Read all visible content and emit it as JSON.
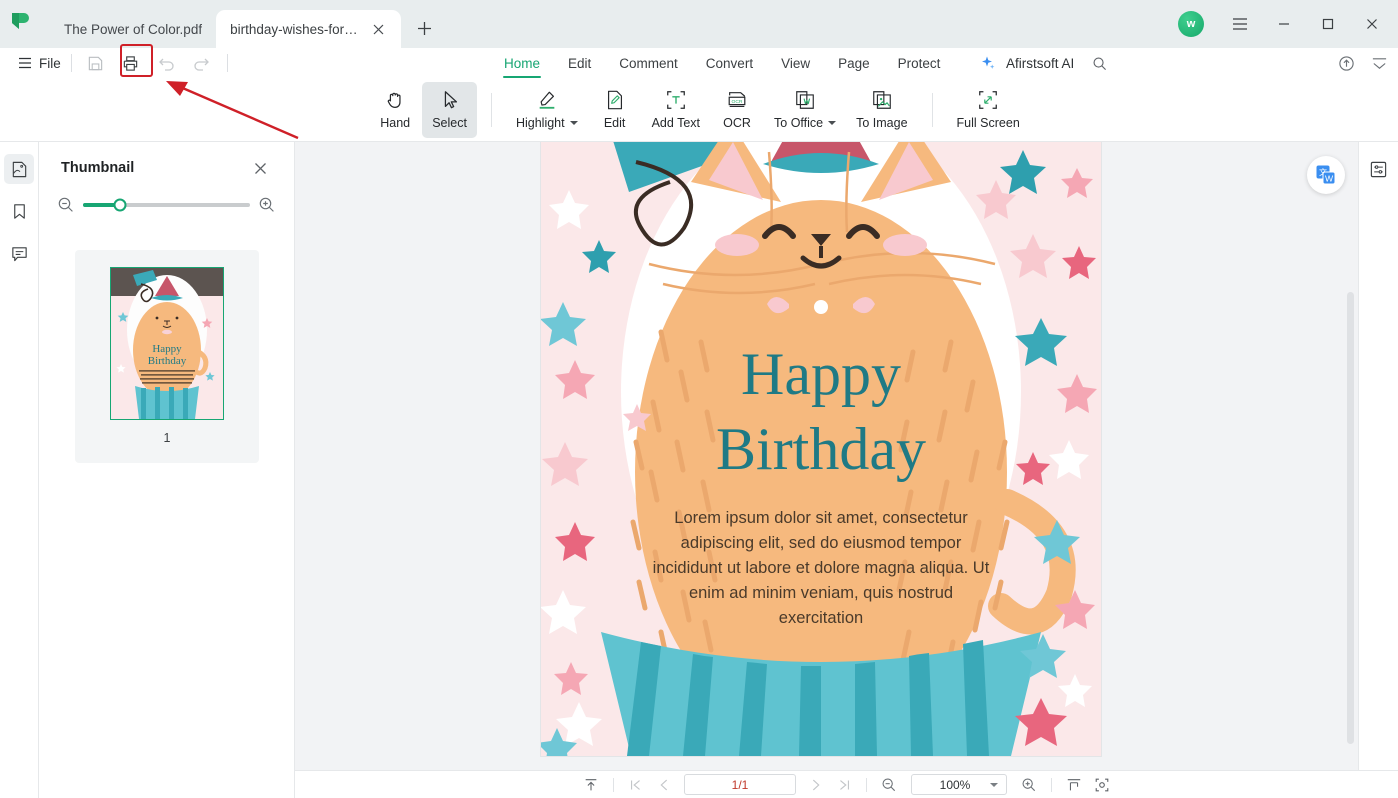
{
  "window": {
    "avatar_initial": "w",
    "controls": [
      "menu-icon",
      "minimize-icon",
      "maximize-icon",
      "close-icon"
    ]
  },
  "tabs": [
    {
      "label": "The Power of Color.pdf",
      "active": false
    },
    {
      "label": "birthday-wishes-for-gra...",
      "active": true
    }
  ],
  "newtab_label": "+",
  "file_menu": {
    "label": "File"
  },
  "quick_actions": [
    {
      "name": "save-button",
      "label": "Save",
      "enabled": true
    },
    {
      "name": "print-button",
      "label": "Print",
      "enabled": true,
      "highlighted": true
    },
    {
      "name": "undo-button",
      "label": "Undo",
      "enabled": false
    },
    {
      "name": "redo-button",
      "label": "Redo",
      "enabled": false
    }
  ],
  "menu_tabs": [
    {
      "label": "Home",
      "active": true
    },
    {
      "label": "Edit",
      "active": false
    },
    {
      "label": "Comment",
      "active": false
    },
    {
      "label": "Convert",
      "active": false
    },
    {
      "label": "View",
      "active": false
    },
    {
      "label": "Page",
      "active": false
    },
    {
      "label": "Protect",
      "active": false
    }
  ],
  "ai": {
    "label": "Afirstsoft AI",
    "icon": "sparkle-icon"
  },
  "menu_right_icons": [
    "search-icon",
    "cloud-upload-icon",
    "collapse-ribbon-icon"
  ],
  "ribbon": [
    {
      "label": "Hand",
      "icon": "hand-icon",
      "active": false,
      "dropdown": false
    },
    {
      "label": "Select",
      "icon": "cursor-icon",
      "active": true,
      "dropdown": false
    },
    {
      "label": "Highlight",
      "icon": "highlighter-icon",
      "active": false,
      "dropdown": true
    },
    {
      "label": "Edit",
      "icon": "edit-document-icon",
      "active": false,
      "dropdown": false
    },
    {
      "label": "Add Text",
      "icon": "add-text-icon",
      "active": false,
      "dropdown": false
    },
    {
      "label": "OCR",
      "icon": "ocr-icon",
      "active": false,
      "dropdown": false
    },
    {
      "label": "To Office",
      "icon": "to-office-icon",
      "active": false,
      "dropdown": true
    },
    {
      "label": "To Image",
      "icon": "to-image-icon",
      "active": false,
      "dropdown": false
    },
    {
      "label": "Full Screen",
      "icon": "fullscreen-icon",
      "active": false,
      "dropdown": false
    }
  ],
  "left_rail": [
    {
      "name": "thumbnail",
      "icon": "thumbnail-icon",
      "active": true
    },
    {
      "name": "bookmark",
      "icon": "bookmark-icon",
      "active": false
    },
    {
      "name": "comment",
      "icon": "comment-icon",
      "active": false
    }
  ],
  "thumbnail_panel": {
    "title": "Thumbnail",
    "close_icon": "close-icon",
    "zoom_out_icon": "zoom-out-icon",
    "zoom_in_icon": "zoom-in-icon",
    "slider_value": 22,
    "pages": [
      {
        "number": "1",
        "selected": true
      }
    ]
  },
  "document": {
    "title_line1": "Happy",
    "title_line2": "Birthday",
    "body": "Lorem ipsum dolor sit amet, consectetur adipiscing elit, sed do eiusmod tempor incididunt ut labore et dolore magna aliqua. Ut enim ad minim veniam, quis nostrud exercitation",
    "colors": {
      "title": "#1f7a85",
      "body": "#4a3a2a",
      "background_pink": "#fbe8e9",
      "cat_body": "#f6b97e",
      "cupcake_teal": "#3aa9b8"
    }
  },
  "float_button": {
    "name": "translate-button",
    "icon": "translate-icon"
  },
  "right_rail": [
    {
      "name": "properties",
      "icon": "sliders-icon"
    }
  ],
  "status_bar": {
    "scroll_top_icon": "scroll-to-top-icon",
    "first_page_icon": "first-page-icon",
    "prev_page_icon": "previous-page-icon",
    "page_value": "1/1",
    "next_page_icon": "next-page-icon",
    "last_page_icon": "last-page-icon",
    "zoom_out_icon": "zoom-out-icon",
    "zoom_value": "100%",
    "zoom_in_icon": "zoom-in-icon",
    "fit_width_icon": "fit-width-icon",
    "fit_page_icon": "fit-page-icon"
  },
  "annotation": {
    "highlight_color": "#cf2028",
    "target": "print-button"
  }
}
